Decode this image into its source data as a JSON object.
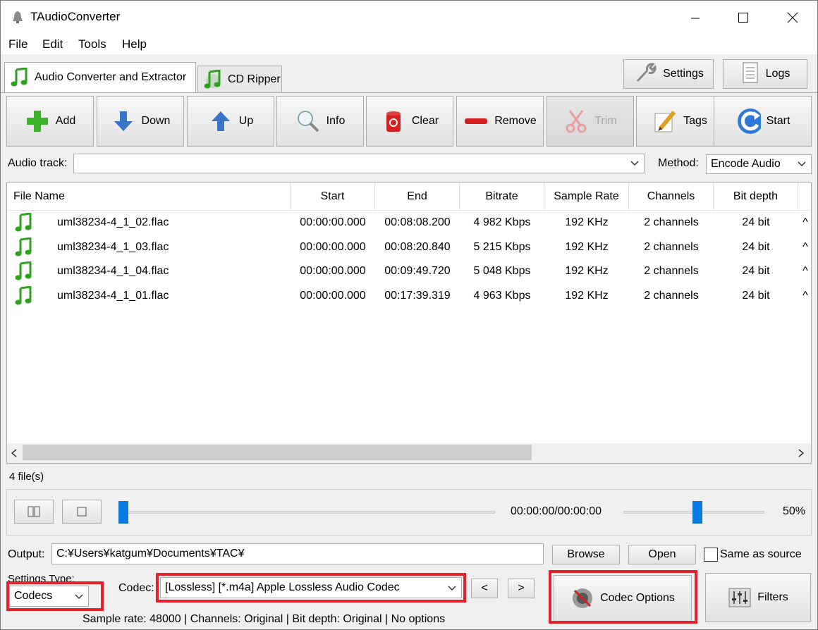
{
  "window": {
    "title": "TAudioConverter"
  },
  "menu": [
    "File",
    "Edit",
    "Tools",
    "Help"
  ],
  "tabs": [
    {
      "label": "Audio Converter and Extractor",
      "active": true
    },
    {
      "label": "CD Ripper",
      "active": false
    }
  ],
  "top_buttons": {
    "settings": "Settings",
    "logs": "Logs"
  },
  "toolbar": {
    "add": "Add",
    "down": "Down",
    "up": "Up",
    "info": "Info",
    "clear": "Clear",
    "remove": "Remove",
    "trim": "Trim",
    "tags": "Tags",
    "start": "Start"
  },
  "audio_track": {
    "label": "Audio track:",
    "value": ""
  },
  "method": {
    "label": "Method:",
    "value": "Encode Audio"
  },
  "table": {
    "columns": [
      "File Name",
      "Start",
      "End",
      "Bitrate",
      "Sample Rate",
      "Channels",
      "Bit depth"
    ],
    "rows": [
      {
        "name": "uml38234-4_1_02.flac",
        "start": "00:00:00.000",
        "end": "00:08:08.200",
        "bitrate": "4 982 Kbps",
        "sample_rate": "192 KHz",
        "channels": "2 channels",
        "bit_depth": "24 bit",
        "more": "^"
      },
      {
        "name": "uml38234-4_1_03.flac",
        "start": "00:00:00.000",
        "end": "00:08:20.840",
        "bitrate": "5 215 Kbps",
        "sample_rate": "192 KHz",
        "channels": "2 channels",
        "bit_depth": "24 bit",
        "more": "^"
      },
      {
        "name": "uml38234-4_1_04.flac",
        "start": "00:00:00.000",
        "end": "00:09:49.720",
        "bitrate": "5 048 Kbps",
        "sample_rate": "192 KHz",
        "channels": "2 channels",
        "bit_depth": "24 bit",
        "more": "^"
      },
      {
        "name": "uml38234-4_1_01.flac",
        "start": "00:00:00.000",
        "end": "00:17:39.319",
        "bitrate": "4 963 Kbps",
        "sample_rate": "192 KHz",
        "channels": "2 channels",
        "bit_depth": "24 bit",
        "more": "^"
      }
    ]
  },
  "file_count": "4 file(s)",
  "player": {
    "time": "00:00:00/00:00:00",
    "volume": "50%",
    "volume_level": 0.5,
    "position_level": 0
  },
  "output": {
    "label": "Output:",
    "path": "C:¥Users¥katgum¥Documents¥TAC¥",
    "browse": "Browse",
    "open": "Open",
    "same_as_source": "Same as source"
  },
  "settings_type": {
    "label": "Settings Type:",
    "value": "Codecs"
  },
  "codec": {
    "label": "Codec:",
    "value": "[Lossless] [*.m4a] Apple Lossless Audio Codec",
    "prev": "<",
    "next": ">"
  },
  "codec_options": "Codec Options",
  "filters": "Filters",
  "status": "Sample rate: 48000 | Channels: Original | Bit depth: Original | No options",
  "colors": {
    "highlight": "#e8202a",
    "accent": "#0a7ae0",
    "note_icon": "#2fa11e"
  }
}
